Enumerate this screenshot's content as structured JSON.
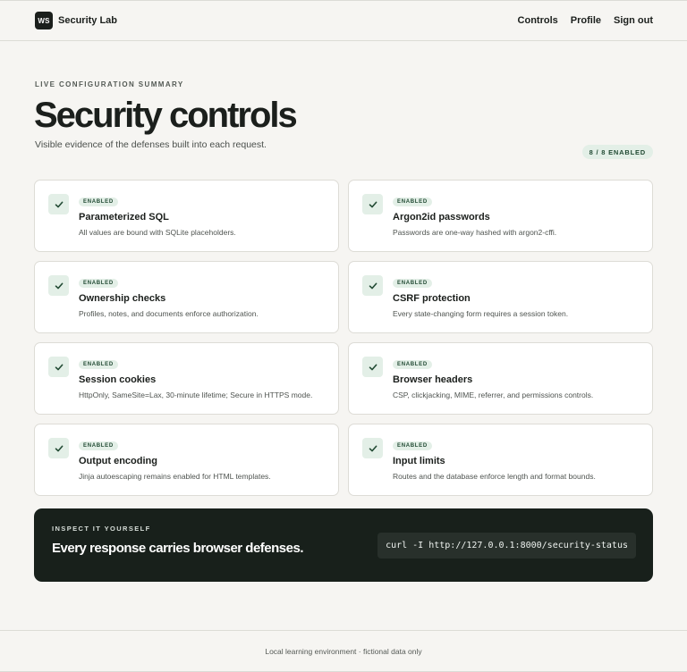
{
  "header": {
    "logo_text": "WS",
    "brand_name": "Security Lab",
    "nav": [
      {
        "label": "Controls"
      },
      {
        "label": "Profile"
      },
      {
        "label": "Sign out"
      }
    ]
  },
  "hero": {
    "eyebrow": "LIVE CONFIGURATION SUMMARY",
    "title": "Security controls",
    "subtitle": "Visible evidence of the defenses built into each request.",
    "count_badge": "8 / 8 ENABLED"
  },
  "controls": [
    {
      "status": "ENABLED",
      "title": "Parameterized SQL",
      "description": "All values are bound with SQLite placeholders.",
      "icon": "check-icon"
    },
    {
      "status": "ENABLED",
      "title": "Argon2id passwords",
      "description": "Passwords are one-way hashed with argon2-cffi.",
      "icon": "check-icon"
    },
    {
      "status": "ENABLED",
      "title": "Ownership checks",
      "description": "Profiles, notes, and documents enforce authorization.",
      "icon": "check-icon"
    },
    {
      "status": "ENABLED",
      "title": "CSRF protection",
      "description": "Every state-changing form requires a session token.",
      "icon": "check-icon"
    },
    {
      "status": "ENABLED",
      "title": "Session cookies",
      "description": "HttpOnly, SameSite=Lax, 30-minute lifetime; Secure in HTTPS mode.",
      "icon": "check-icon"
    },
    {
      "status": "ENABLED",
      "title": "Browser headers",
      "description": "CSP, clickjacking, MIME, referrer, and permissions controls.",
      "icon": "check-icon"
    },
    {
      "status": "ENABLED",
      "title": "Output encoding",
      "description": "Jinja autoescaping remains enabled for HTML templates.",
      "icon": "check-icon"
    },
    {
      "status": "ENABLED",
      "title": "Input limits",
      "description": "Routes and the database enforce length and format bounds.",
      "icon": "check-icon"
    }
  ],
  "inspect": {
    "eyebrow": "INSPECT IT YOURSELF",
    "title": "Every response carries browser defenses.",
    "command": "curl -I http://127.0.0.1:8000/security-status"
  },
  "footer": {
    "text": "Local learning environment · fictional data only"
  },
  "colors": {
    "accent_dark": "#18201b",
    "success_bg": "#e3efe7",
    "success_fg": "#214a33",
    "page_bg": "#f6f5f2"
  }
}
